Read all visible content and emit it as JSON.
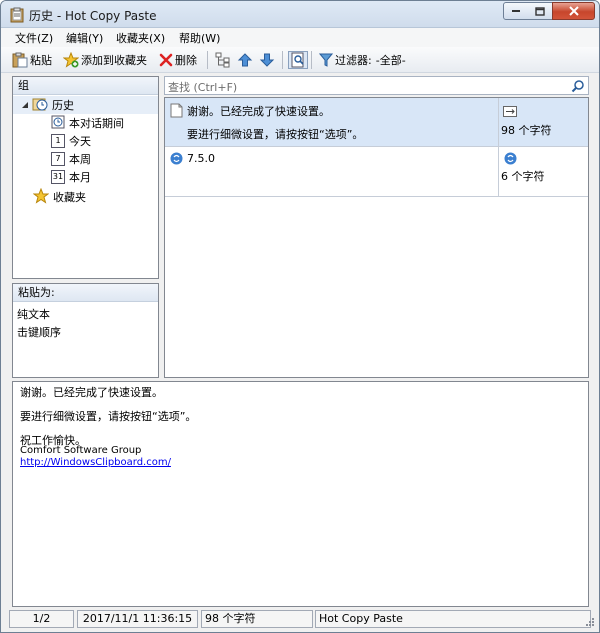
{
  "window": {
    "title": "历史 - Hot Copy Paste"
  },
  "menu": {
    "items": [
      "文件(Z)",
      "编辑(Y)",
      "收藏夹(X)",
      "帮助(W)"
    ]
  },
  "toolbar": {
    "paste": "粘贴",
    "add_favorite": "添加到收藏夹",
    "delete": "删除",
    "filter_label": "过滤器:",
    "filter_value": "-全部-"
  },
  "groups": {
    "header": "组",
    "history": "历史",
    "this_session": "本对话期间",
    "today": "今天",
    "this_week": "本周",
    "this_month": "本月",
    "favorites": "收藏夹",
    "today_icon_num": "1",
    "week_icon_num": "7",
    "month_icon_num": "31"
  },
  "paste_as": {
    "header": "粘贴为:",
    "options": [
      "纯文本",
      "击键顺序"
    ]
  },
  "search": {
    "placeholder": "查找 (Ctrl+F)"
  },
  "clips": [
    {
      "line1": "谢谢。已经完成了快速设置。",
      "line2": "要进行细微设置，请按按钮“选项”。",
      "size": "98 个字符"
    },
    {
      "line1": "7.5.0",
      "size": "6 个字符"
    }
  ],
  "preview": {
    "line1": "谢谢。已经完成了快速设置。",
    "line2": "要进行细微设置，请按按钮“选项”。",
    "line3": "祝工作愉快。",
    "line4": "Comfort Software Group",
    "link": "http://WindowsClipboard.com/"
  },
  "status": {
    "position": "1/2",
    "datetime": "2017/11/1 11:36:15",
    "chars": "98 个字符",
    "app": "Hot Copy Paste"
  }
}
